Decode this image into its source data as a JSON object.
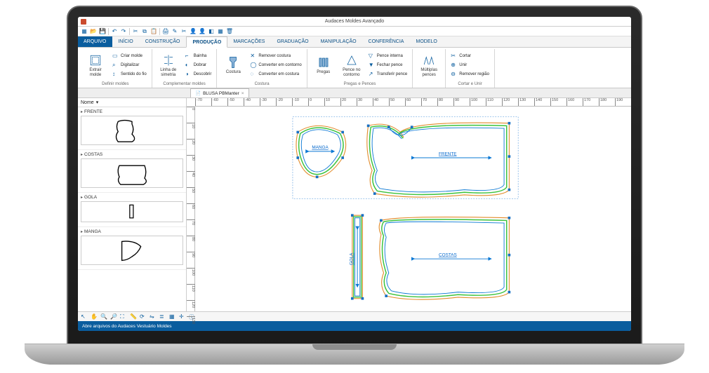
{
  "app": {
    "title": "Audaces Moldes Avançado"
  },
  "tabs": {
    "file": "ARQUIVO",
    "items": [
      "INÍCIO",
      "CONSTRUÇÃO",
      "PRODUÇÃO",
      "MARCAÇÕES",
      "GRADUAÇÃO",
      "MANIPULAÇÃO",
      "CONFERÊNCIA",
      "MODELO"
    ],
    "active_index": 2
  },
  "ribbon": {
    "groups": [
      {
        "label": "Definir moldes",
        "big": [
          {
            "name": "extrair-molde",
            "text": "Extrair molde"
          }
        ],
        "small": [
          {
            "text": "Criar molde"
          },
          {
            "text": "Digitalizar"
          },
          {
            "text": "Sentido do fio"
          }
        ]
      },
      {
        "label": "Complementar moldes",
        "big": [
          {
            "name": "linha-simetria",
            "text": "Linha de simetria"
          }
        ],
        "small": [
          {
            "text": "Bainha"
          },
          {
            "text": "Dobrar"
          },
          {
            "text": "Descobrir"
          }
        ]
      },
      {
        "label": "Costura",
        "big": [
          {
            "name": "costura",
            "text": "Costura"
          }
        ],
        "small": [
          {
            "text": "Remover costura"
          },
          {
            "text": "Converter em contorno"
          },
          {
            "text": "Converter em costura"
          }
        ]
      },
      {
        "label": "Pregas e Pences",
        "big": [
          {
            "name": "pregas",
            "text": "Pregas"
          },
          {
            "name": "pence-contorno",
            "text": "Pence no contorno"
          }
        ],
        "small": [
          {
            "text": "Pence interna"
          },
          {
            "text": "Fechar pence"
          },
          {
            "text": "Transferir pence"
          }
        ]
      },
      {
        "label": "",
        "big": [
          {
            "name": "multiplas-pences",
            "text": "Múltiplas pences"
          }
        ],
        "small": []
      },
      {
        "label": "Cortar e Unir",
        "big": [],
        "small": [
          {
            "text": "Cortar"
          },
          {
            "text": "Unir"
          },
          {
            "text": "Remover região"
          }
        ]
      }
    ]
  },
  "side": {
    "title": "Nome",
    "thumbs": [
      {
        "label": "FRENTE"
      },
      {
        "label": "COSTAS"
      },
      {
        "label": "GOLA"
      },
      {
        "label": "MANGA"
      }
    ]
  },
  "doc": {
    "name": "BLUSA PBManter"
  },
  "ruler_h": [
    -70,
    -60,
    -50,
    -40,
    -30,
    -20,
    -10,
    0,
    10,
    20,
    30,
    40,
    50,
    60,
    70,
    80,
    90,
    100,
    110,
    120,
    130,
    140,
    150,
    160,
    170,
    180,
    190
  ],
  "ruler_v": [
    0,
    10,
    20,
    30,
    40,
    50,
    60,
    70,
    80,
    90,
    100,
    110,
    120,
    130
  ],
  "pieces": {
    "manga": "MANGA",
    "frente": "FRENTE",
    "gola": "GOLA",
    "costas": "COSTAS"
  },
  "status": "Abre arquivos do Audaces Vestuário Moldes"
}
